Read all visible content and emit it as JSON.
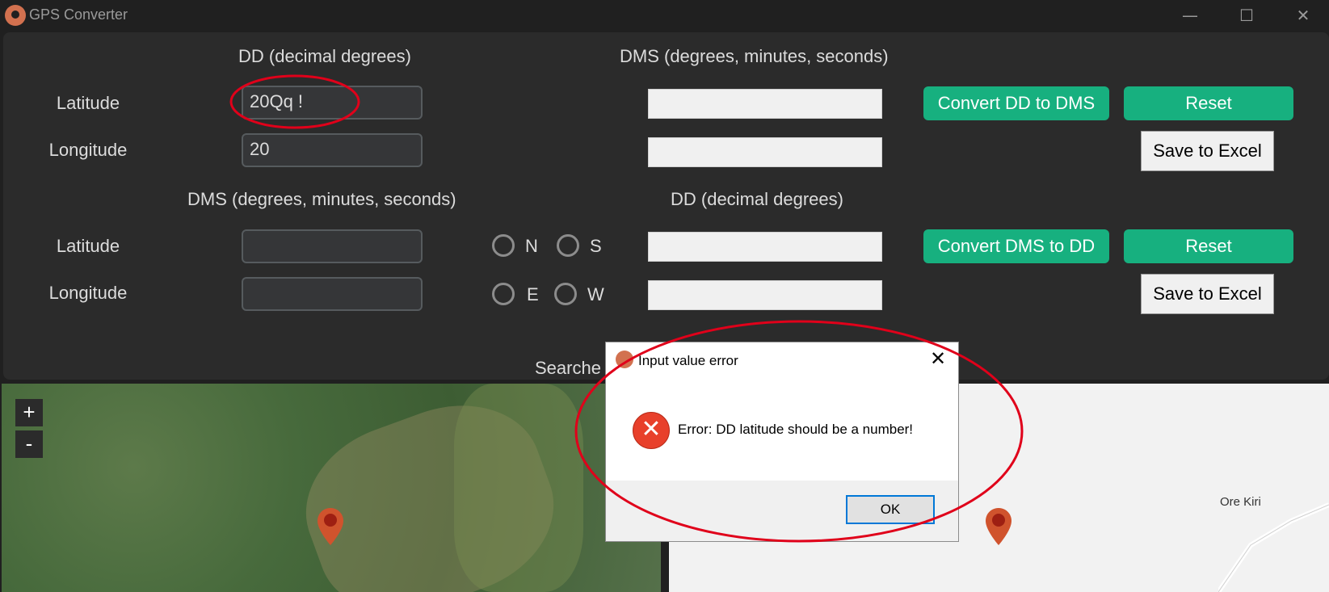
{
  "window": {
    "title": "GPS Converter",
    "minimize_icon": "minimize-icon",
    "maximize_icon": "maximize-icon",
    "close_icon": "close-icon"
  },
  "dd_to_dms": {
    "dd_header": "DD (decimal degrees)",
    "dms_header": "DMS (degrees, minutes, seconds)",
    "lat_label": "Latitude",
    "lon_label": "Longitude",
    "lat_value": "20Qq !",
    "lon_value": "20",
    "dms_lat_value": "",
    "dms_lon_value": "",
    "convert_label": "Convert DD to DMS",
    "reset_label": "Reset",
    "save_label": "Save to Excel"
  },
  "dms_to_dd": {
    "dms_header": "DMS (degrees, minutes, seconds)",
    "dd_header": "DD (decimal degrees)",
    "lat_label": "Latitude",
    "lon_label": "Longitude",
    "lat_value": "",
    "lon_value": "",
    "radio_n": "N",
    "radio_s": "S",
    "radio_e": "E",
    "radio_w": "W",
    "dd_lat_value": "",
    "dd_lon_value": "",
    "convert_label": "Convert DMS to DD",
    "reset_label": "Reset",
    "save_label": "Save to Excel"
  },
  "searched_label": "Searche",
  "map": {
    "zoom_in": "+",
    "zoom_out": "-",
    "place_label": "Ore Kiri"
  },
  "dialog": {
    "title": "Input value error",
    "message": "Error: DD latitude should be a number!",
    "ok_label": "OK",
    "close_icon": "close-icon",
    "error_icon": "error-icon"
  },
  "colors": {
    "accent_green": "#17b07f",
    "annotation_red": "#e0001a",
    "panel": "#2b2b2b",
    "pin": "#d0532d"
  }
}
